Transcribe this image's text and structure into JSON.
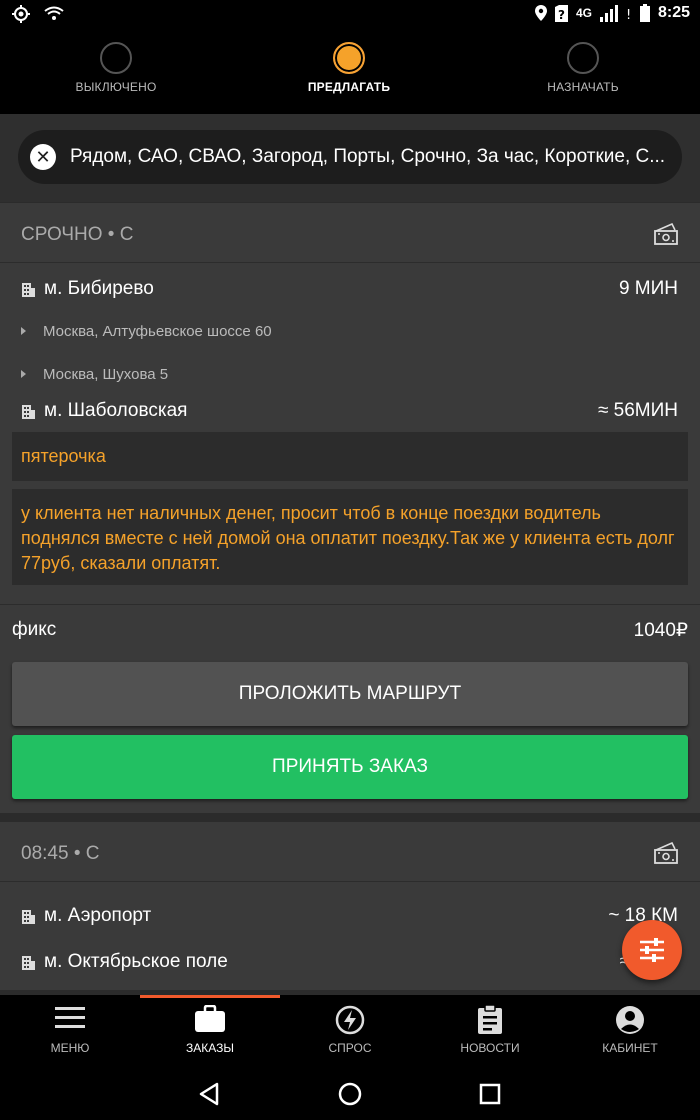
{
  "status": {
    "network": "4G",
    "time": "8:25"
  },
  "modes": [
    {
      "label": "ВЫКЛЮЧЕНО",
      "active": false
    },
    {
      "label": "ПРЕДЛАГАТЬ",
      "active": true
    },
    {
      "label": "НАЗНАЧАТЬ",
      "active": false
    }
  ],
  "filter": {
    "text": "Рядом, САО, СВАО, Загород, Порты, Срочно, За час, Короткие, С..."
  },
  "order1": {
    "title": "СРОЧНО • С",
    "from": {
      "metro": "м. Бибирево",
      "eta": "9 МИН"
    },
    "addresses": [
      "Москва, Алтуфьевское шоссе 60",
      "Москва, Шухова 5"
    ],
    "to": {
      "metro": "м. Шаболовская",
      "duration": "≈ 56МИН"
    },
    "note_short": "пятерочка",
    "note_long": "у клиента нет наличных денег, просит чтоб в конце поездки водитель поднялся вместе с ней домой она оплатит поездку.Так же у клиента есть долг 77руб, сказали оплатят.",
    "price_type": "фикс",
    "price": "1040₽",
    "route_button": "ПРОЛОЖИТЬ МАРШРУТ",
    "accept_button": "ПРИНЯТЬ ЗАКАЗ"
  },
  "order2": {
    "title": "08:45 • С",
    "from": {
      "metro": "м. Аэропорт",
      "distance": "~ 18 КМ"
    },
    "to": {
      "metro": "м. Октябрьское поле",
      "duration": "≈"
    }
  },
  "tabs": [
    {
      "label": "МЕНЮ",
      "icon": "menu-icon"
    },
    {
      "label": "ЗАКАЗЫ",
      "icon": "briefcase-icon",
      "active": true
    },
    {
      "label": "СПРОС",
      "icon": "lightning-icon"
    },
    {
      "label": "НОВОСТИ",
      "icon": "clipboard-icon"
    },
    {
      "label": "КАБИНЕТ",
      "icon": "account-icon"
    }
  ],
  "colors": {
    "accent_orange": "#f5a22a",
    "accept_green": "#22c062",
    "fab_red": "#f15a2c"
  }
}
